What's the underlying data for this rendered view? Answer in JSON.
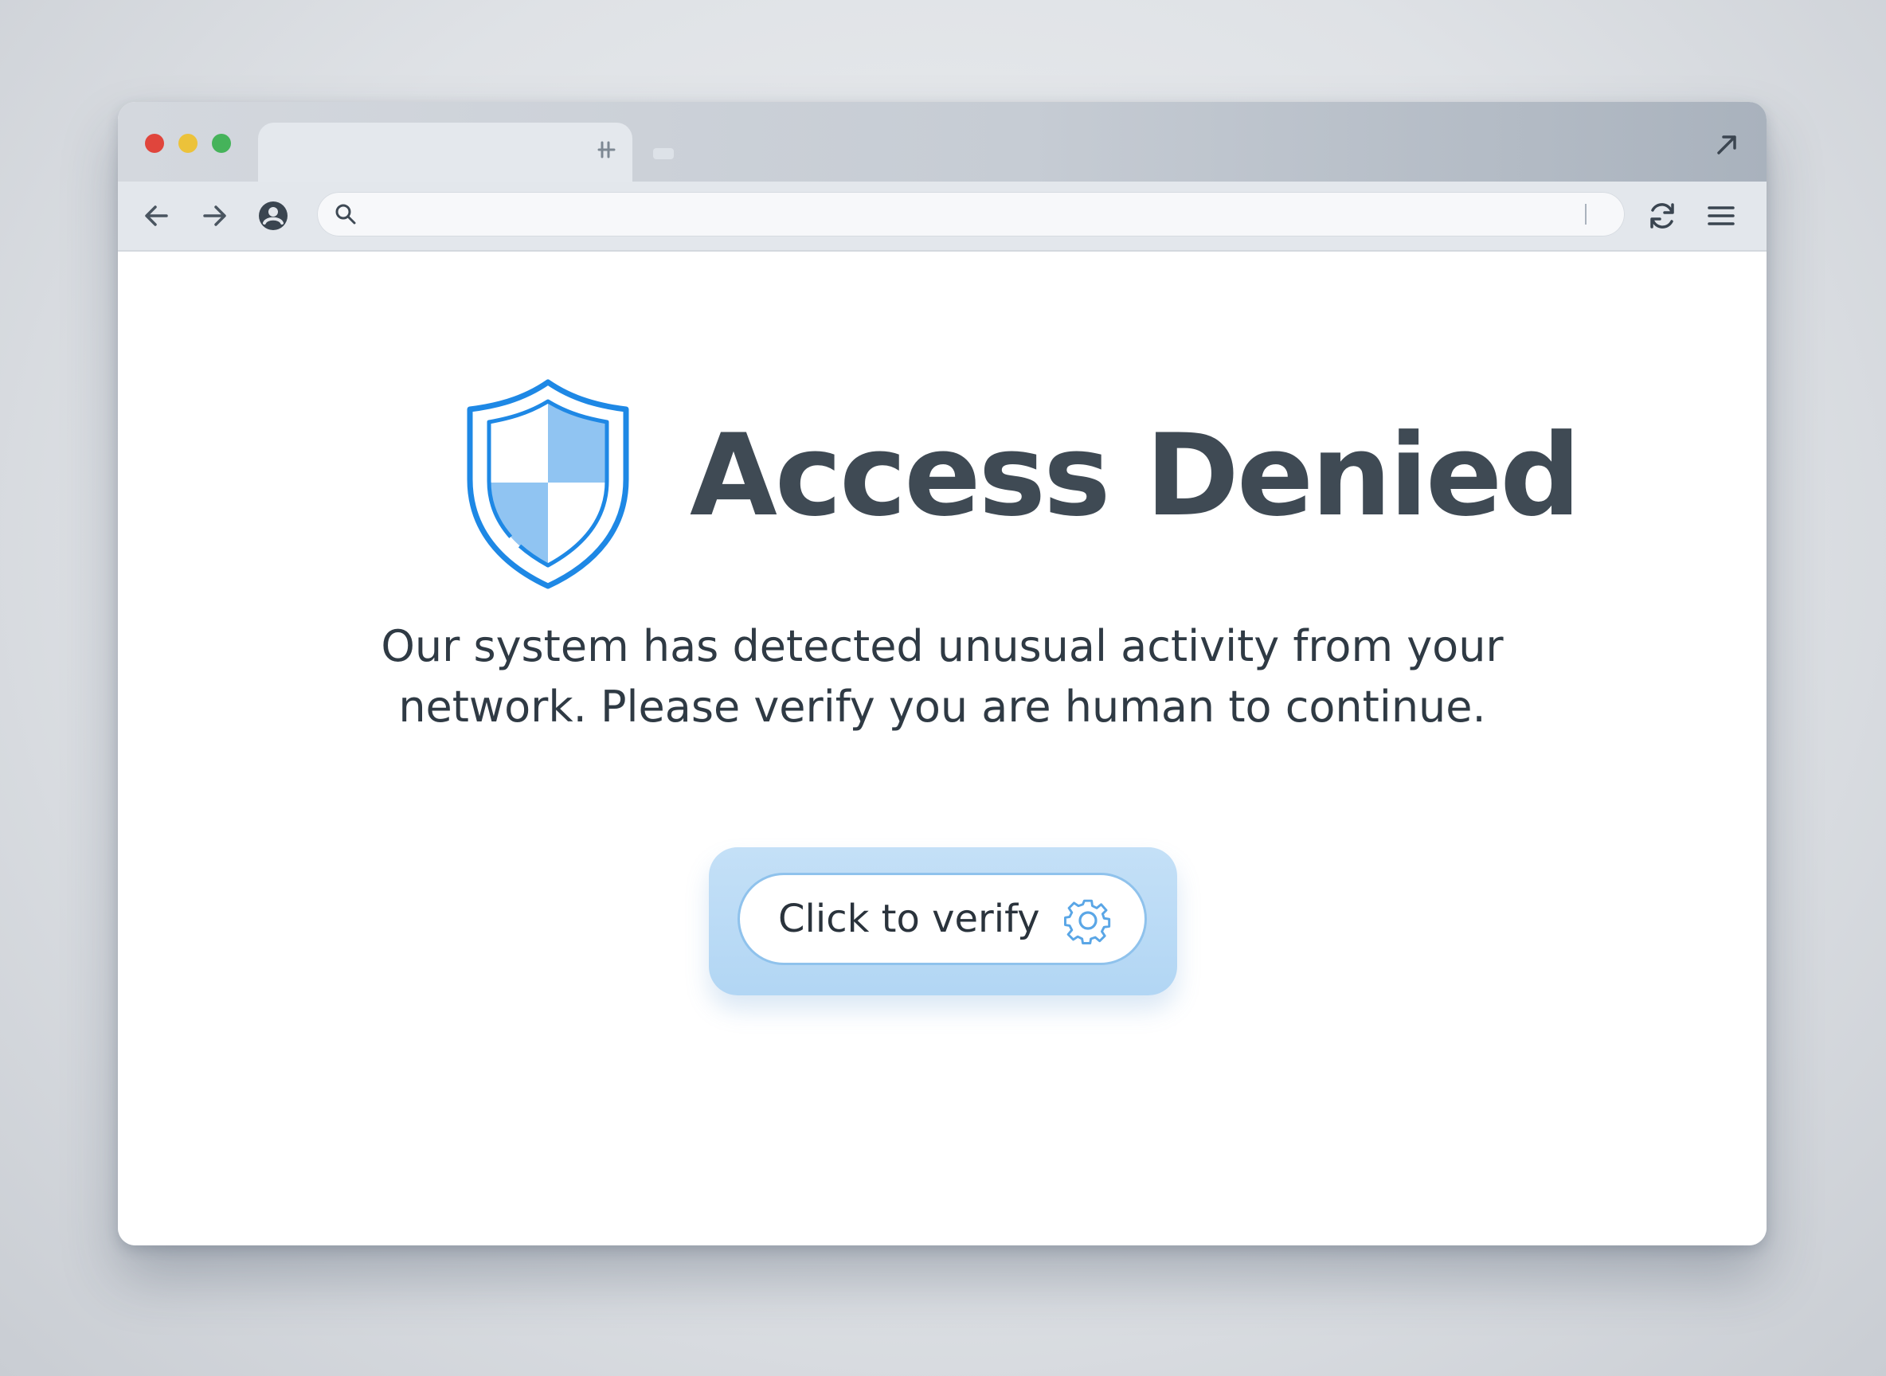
{
  "browser": {
    "address_bar": {
      "value": "",
      "placeholder": ""
    },
    "icons": {
      "back": "arrow-left-icon",
      "forward": "arrow-right-icon",
      "profile": "account-icon",
      "search": "search-icon",
      "reload": "reload-icon",
      "menu": "hamburger-menu-icon",
      "new_tab": "new-tab-icon",
      "expand": "expand-arrow-icon"
    }
  },
  "page": {
    "title": "Access Denied",
    "message": "Our system has detected unusual activity from your network. Please verify you are human to continue.",
    "verify_button_label": "Click to verify",
    "icons": {
      "shield": "shield-icon",
      "verify": "gear-icon"
    }
  },
  "colors": {
    "accent": "#1e88e5",
    "accent_light": "#90c4f2",
    "heading": "#3f4a54",
    "text": "#2f3a44"
  }
}
